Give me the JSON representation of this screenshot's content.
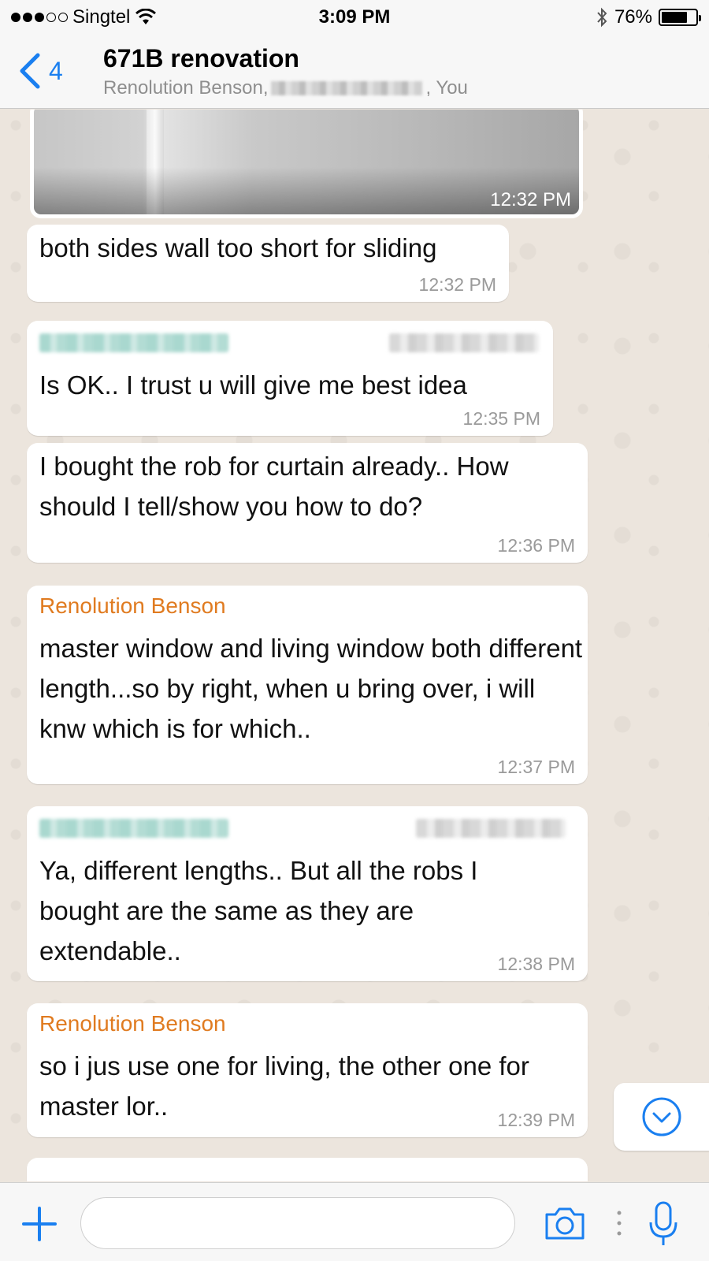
{
  "status_bar": {
    "carrier": "Singtel",
    "time": "3:09 PM",
    "battery": "76%",
    "battery_level": 0.76,
    "signal_bars": 3,
    "icons": [
      "wifi-icon",
      "bluetooth-icon",
      "battery-icon"
    ]
  },
  "header": {
    "back_count": "4",
    "title": "671B renovation",
    "participants_prefix": "Renolution Benson,",
    "participants_suffix": ", You"
  },
  "messages": [
    {
      "type": "image",
      "time": "12:32 PM"
    },
    {
      "type": "text",
      "text": "both sides wall too short for sliding",
      "time": "12:32 PM"
    },
    {
      "type": "text",
      "sender_hidden": true,
      "text": "Is OK.. I trust u will give me best idea",
      "time": "12:35 PM"
    },
    {
      "type": "text",
      "text": "I bought the rob for curtain already.. How should I tell/show you how to do?",
      "time": "12:36 PM"
    },
    {
      "type": "text",
      "sender": "Renolution Benson",
      "text": "master window and living window both different length...so by right, when u bring over, i will knw which is for which..",
      "time": "12:37 PM"
    },
    {
      "type": "text",
      "sender_hidden": true,
      "text": "Ya, different lengths.. But all the robs I bought are the same as they are extendable..",
      "time": "12:38 PM"
    },
    {
      "type": "text",
      "sender": "Renolution Benson",
      "text": "so i jus use one for living, the other one for master lor..",
      "time": "12:39 PM"
    }
  ],
  "input": {
    "placeholder": "",
    "value": ""
  },
  "colors": {
    "accent": "#1a7ff0",
    "sender_name": "#e07b20",
    "chat_background": "#ece5dd"
  }
}
